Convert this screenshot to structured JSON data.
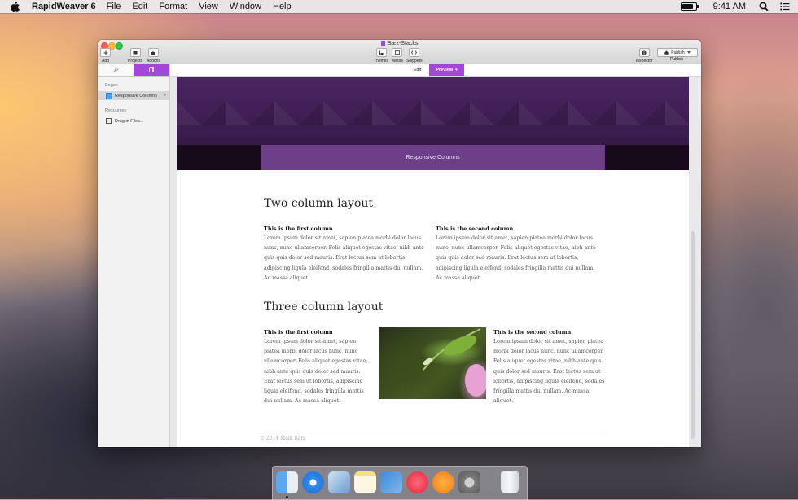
{
  "menubar": {
    "app_name": "RapidWeaver 6",
    "items": [
      "File",
      "Edit",
      "Format",
      "View",
      "Window",
      "Help"
    ],
    "clock": "9:41 AM",
    "battery_level": 0.85
  },
  "window": {
    "document_title": "Barz-Stacks",
    "toolbar": {
      "add": "Add",
      "projects": "Projects",
      "addons": "Addons",
      "themes": "Themes",
      "media": "Media",
      "snippets": "Snippets",
      "inspector": "Inspector",
      "publish_button": "Publish",
      "publish_label": "Publish"
    }
  },
  "sidebar": {
    "pages_header": "Pages",
    "page_item": "Responsive Columns",
    "resources_header": "Resources",
    "resource_item": "Drag in Files..."
  },
  "view_tabs": {
    "edit": "Edit",
    "preview": "Preview"
  },
  "preview": {
    "banner_title": "Responsive Columns",
    "two_col": {
      "heading": "Two column layout",
      "col1_title": "This is the first column",
      "col1_text": "Lorem ipsum dolor sit amet, sapien platea morbi dolor lacus nunc, nunc ullamcorper. Felis aliquet egestas vitae, nibh ante quis quis dolor sed mauris. Erat lectus sem ut lobortis, adipiscing ligula eleifend, sodales fringilla mattis dui nullam. Ac massa aliquet.",
      "col2_title": "This is the second column",
      "col2_text": "Lorem ipsum dolor sit amet, sapien platea morbi dolor lacus nunc, nunc ullamcorper. Felis aliquet egestas vitae, nibh ante quis quis dolor sed mauris. Erat lectus sem ut lobortis, adipiscing ligula eleifend, sodales fringilla mattis dui nullam. Ac massa aliquet."
    },
    "three_col": {
      "heading": "Three column layout",
      "col1_title": "This is the first column",
      "col1_text": "Lorem ipsum dolor sit amet, sapien platea morbi dolor lacus nunc, nunc ullamcorper. Felis aliquet egestas vitae, nibh ante quis quis dolor sed mauris. Erat lectus sem ut lobortis, adipiscing ligula eleifend, sodales fringilla mattis dui nullam. Ac massa aliquet.",
      "col3_title": "This is the second column",
      "col3_text": "Lorem ipsum dolor sit amet, sapien platea morbi dolor lacus nunc, nunc ullamcorper. Felis aliquet egestas vitae, nibh ante quis quis dolor sed mauris. Erat lectus sem ut lobortis, adipiscing ligula eleifend, sodales fringilla mattis dui nullam. Ac massa aliquet."
    },
    "footer": "© 2014 Maik Barz"
  },
  "dock": {
    "icons": [
      "finder-icon",
      "safari-icon",
      "preview-icon",
      "notes-icon",
      "xcode-icon",
      "itunes-icon",
      "ibooks-icon",
      "system-preferences-icon",
      "trash-icon"
    ]
  },
  "colors": {
    "accent": "#a446d8",
    "banner": "#6c3f88"
  }
}
